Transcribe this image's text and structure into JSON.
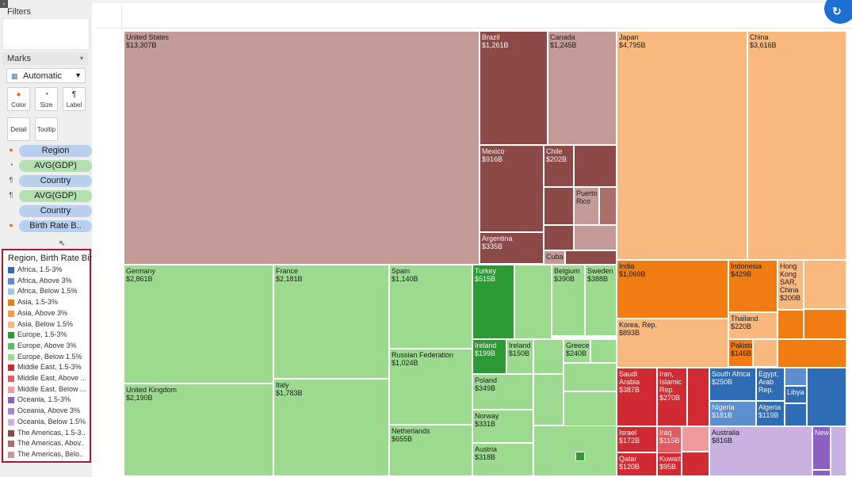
{
  "sidebar": {
    "filters_label": "Filters",
    "marks_label": "Marks",
    "mark_type": "Automatic",
    "buttons": {
      "color": "Color",
      "size": "Size",
      "label": "Label",
      "detail": "Detail",
      "tooltip": "Tooltip"
    },
    "shelf": [
      {
        "icon": "color-icon",
        "field": "Region",
        "kind": "dim"
      },
      {
        "icon": "size-icon",
        "field": "AVG(GDP)",
        "kind": "meas"
      },
      {
        "icon": "label-icon",
        "field": "Country",
        "kind": "dim"
      },
      {
        "icon": "label-icon",
        "field": "AVG(GDP)",
        "kind": "meas"
      },
      {
        "icon": "",
        "field": "Country",
        "kind": "dim"
      },
      {
        "icon": "color-icon",
        "field": "Birth Rate B..",
        "kind": "dim"
      }
    ]
  },
  "legend": {
    "title": "Region, Birth Rate Bin",
    "items": [
      {
        "label": "Africa, 1.5-3%",
        "color": "#2e6db5"
      },
      {
        "label": "Africa, Above 3%",
        "color": "#5d8ed0"
      },
      {
        "label": "Africa, Below 1.5%",
        "color": "#a8c3e8"
      },
      {
        "label": "Asia, 1.5-3%",
        "color": "#f07c12"
      },
      {
        "label": "Asia, Above 3%",
        "color": "#f59a45"
      },
      {
        "label": "Asia, Below 1.5%",
        "color": "#f9b87d"
      },
      {
        "label": "Europe, 1.5-3%",
        "color": "#2c9a35"
      },
      {
        "label": "Europe, Above 3%",
        "color": "#5bbd5f"
      },
      {
        "label": "Europe, Below 1.5%",
        "color": "#9cdb8f"
      },
      {
        "label": "Middle East, 1.5-3%",
        "color": "#d12a32"
      },
      {
        "label": "Middle East, Above ...",
        "color": "#e25b62"
      },
      {
        "label": "Middle East, Below ...",
        "color": "#ef9a9d"
      },
      {
        "label": "Oceania, 1.5-3%",
        "color": "#8c5fc0"
      },
      {
        "label": "Oceania, Above 3%",
        "color": "#a886d1"
      },
      {
        "label": "Oceania, Below 1.5%",
        "color": "#c9b1e2"
      },
      {
        "label": "The Americas, 1.5-3..",
        "color": "#8b4a47"
      },
      {
        "label": "The Americas, Abov..",
        "color": "#a86f6b"
      },
      {
        "label": "The Americas, Belo..",
        "color": "#c39a96"
      }
    ]
  },
  "chart_data": {
    "type": "treemap",
    "size_measure": "AVG(GDP)",
    "color_dimension": "Region, Birth Rate Bin",
    "labeled_tiles": [
      {
        "name": "United States",
        "value": "$13,307B",
        "group": "The Americas, Below 1.5%"
      },
      {
        "name": "Brazil",
        "value": "$1,261B",
        "group": "The Americas, 1.5-3%"
      },
      {
        "name": "Canada",
        "value": "$1,245B",
        "group": "The Americas, Below 1.5%"
      },
      {
        "name": "Mexico",
        "value": "$916B",
        "group": "The Americas, 1.5-3%"
      },
      {
        "name": "Chile",
        "value": "$202B",
        "group": "The Americas, 1.5-3%"
      },
      {
        "name": "Puerto Rico",
        "value": "",
        "group": "The Americas, Below 1.5%"
      },
      {
        "name": "Argentina",
        "value": "$335B",
        "group": "The Americas, 1.5-3%"
      },
      {
        "name": "Cuba",
        "value": "",
        "group": "The Americas, Below 1.5%"
      },
      {
        "name": "Japan",
        "value": "$4,795B",
        "group": "Asia, Below 1.5%"
      },
      {
        "name": "China",
        "value": "$3,616B",
        "group": "Asia, Below 1.5%"
      },
      {
        "name": "India",
        "value": "$1,069B",
        "group": "Asia, 1.5-3%"
      },
      {
        "name": "Indonesia",
        "value": "$429B",
        "group": "Asia, 1.5-3%"
      },
      {
        "name": "Hong Kong SAR, China",
        "value": "$200B",
        "group": "Asia, Below 1.5%"
      },
      {
        "name": "Korea, Rep.",
        "value": "$893B",
        "group": "Asia, Below 1.5%"
      },
      {
        "name": "Thailand",
        "value": "$220B",
        "group": "Asia, Below 1.5%"
      },
      {
        "name": "Pakistan",
        "value": "$146B",
        "group": "Asia, 1.5-3%"
      },
      {
        "name": "Germany",
        "value": "$2,861B",
        "group": "Europe, Below 1.5%"
      },
      {
        "name": "France",
        "value": "$2,181B",
        "group": "Europe, Below 1.5%"
      },
      {
        "name": "Spain",
        "value": "$1,140B",
        "group": "Europe, Below 1.5%"
      },
      {
        "name": "Turkey",
        "value": "$515B",
        "group": "Europe, 1.5-3%"
      },
      {
        "name": "Belgium",
        "value": "$390B",
        "group": "Europe, Below 1.5%"
      },
      {
        "name": "Sweden",
        "value": "$388B",
        "group": "Europe, Below 1.5%"
      },
      {
        "name": "Russian Federation",
        "value": "$1,024B",
        "group": "Europe, Below 1.5%"
      },
      {
        "name": "Ireland",
        "value": "$199B",
        "group": "Europe, 1.5-3%"
      },
      {
        "name": "Ireland",
        "value": "$150B",
        "group": "Europe, Below 1.5%"
      },
      {
        "name": "Greece",
        "value": "$240B",
        "group": "Europe, Below 1.5%"
      },
      {
        "name": "United Kingdom",
        "value": "$2,190B",
        "group": "Europe, Below 1.5%"
      },
      {
        "name": "Italy",
        "value": "$1,783B",
        "group": "Europe, Below 1.5%"
      },
      {
        "name": "Poland",
        "value": "$349B",
        "group": "Europe, Below 1.5%"
      },
      {
        "name": "Norway",
        "value": "$331B",
        "group": "Europe, Below 1.5%"
      },
      {
        "name": "Netherlands",
        "value": "$655B",
        "group": "Europe, Below 1.5%"
      },
      {
        "name": "Austria",
        "value": "$318B",
        "group": "Europe, Below 1.5%"
      },
      {
        "name": "Saudi Arabia",
        "value": "$387B",
        "group": "Middle East, 1.5-3%"
      },
      {
        "name": "Iran, Islamic Rep.",
        "value": "$270B",
        "group": "Middle East, 1.5-3%"
      },
      {
        "name": "Israel",
        "value": "$172B",
        "group": "Middle East, 1.5-3%"
      },
      {
        "name": "Iraq",
        "value": "$115B",
        "group": "Middle East, Above 3%"
      },
      {
        "name": "Qatar",
        "value": "$120B",
        "group": "Middle East, 1.5-3%"
      },
      {
        "name": "Kuwait",
        "value": "$95B",
        "group": "Middle East, 1.5-3%"
      },
      {
        "name": "South Africa",
        "value": "$250B",
        "group": "Africa, 1.5-3%"
      },
      {
        "name": "Egypt, Arab Rep.",
        "value": "",
        "group": "Africa, 1.5-3%"
      },
      {
        "name": "Libya",
        "value": "",
        "group": "Africa, 1.5-3%"
      },
      {
        "name": "Nigeria",
        "value": "$181B",
        "group": "Africa, Above 3%"
      },
      {
        "name": "Algeria",
        "value": "$119B",
        "group": "Africa, 1.5-3%"
      },
      {
        "name": "Australia",
        "value": "$816B",
        "group": "Oceania, Below 1.5%"
      },
      {
        "name": "New",
        "value": "",
        "group": "Oceania, 1.5-3%"
      }
    ]
  }
}
